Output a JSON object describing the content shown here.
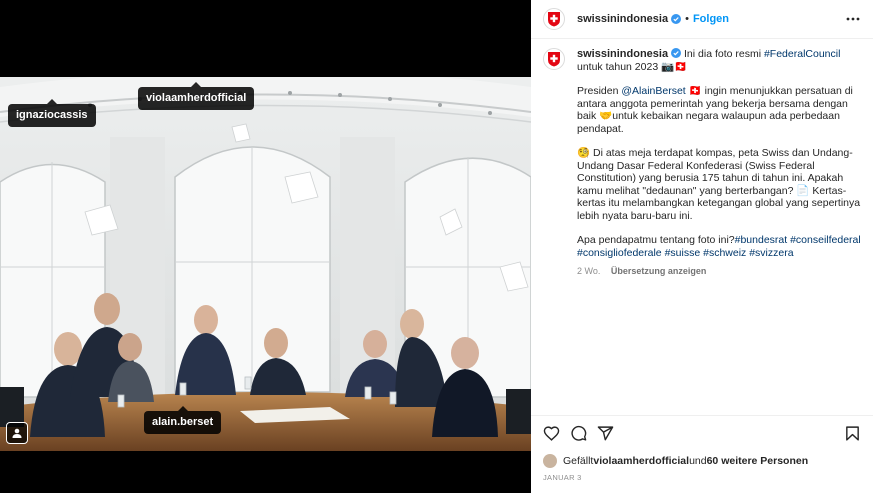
{
  "account": {
    "username": "swissinindonesia",
    "follow_label": "Folgen",
    "separator": "•"
  },
  "tags": {
    "ignazio": "ignaziocassis",
    "viola": "violaamherdofficial",
    "alain": "alain.berset"
  },
  "caption": {
    "username": "swissinindonesia",
    "line1_pre": "Ini dia foto resmi ",
    "line1_hashtag": "#FederalCouncil",
    "line1_post": " untuk tahun 2023 📷🇨🇭",
    "p2_pre": "Presiden ",
    "p2_mention": "@AlainBerset",
    "p2_post": " 🇨🇭 ingin menunjukkan persatuan di antara anggota pemerintah yang bekerja bersama dengan baik 🤝untuk kebaikan negara walaupun ada perbedaan pendapat.",
    "p3": "🧐 Di atas meja terdapat kompas, peta Swiss dan Undang-Undang Dasar Federal Konfederasi (Swiss Federal Constitution) yang berusia 175 tahun di tahun ini. Apakah kamu melihat \"dedaunan\" yang berterbangan? 📄 Kertas-kertas itu melambangkan ketegangan global yang sepertinya lebih nyata baru-baru ini.",
    "p4_pre": "Apa pendapatmu tentang foto ini?",
    "hashtags": [
      "#bundesrat",
      "#conseilfederal",
      "#consigliofederale",
      "#suisse",
      "#schweiz",
      "#svizzera"
    ],
    "time_ago": "2 Wo.",
    "translate_label": "Übersetzung anzeigen"
  },
  "likes": {
    "prefix": "Gefällt ",
    "user": "violaamherdofficial",
    "middle": " und ",
    "others": "60 weitere Personen"
  },
  "date": "JANUAR 3",
  "colors": {
    "swiss_red": "#e30613",
    "link": "#00376b",
    "follow_blue": "#0095f6",
    "verified_blue": "#3897f0"
  },
  "icons": [
    "swiss-flag-icon",
    "verified-icon",
    "more-options-icon",
    "heart-icon",
    "comment-icon",
    "share-icon",
    "bookmark-icon",
    "user-tag-icon"
  ]
}
